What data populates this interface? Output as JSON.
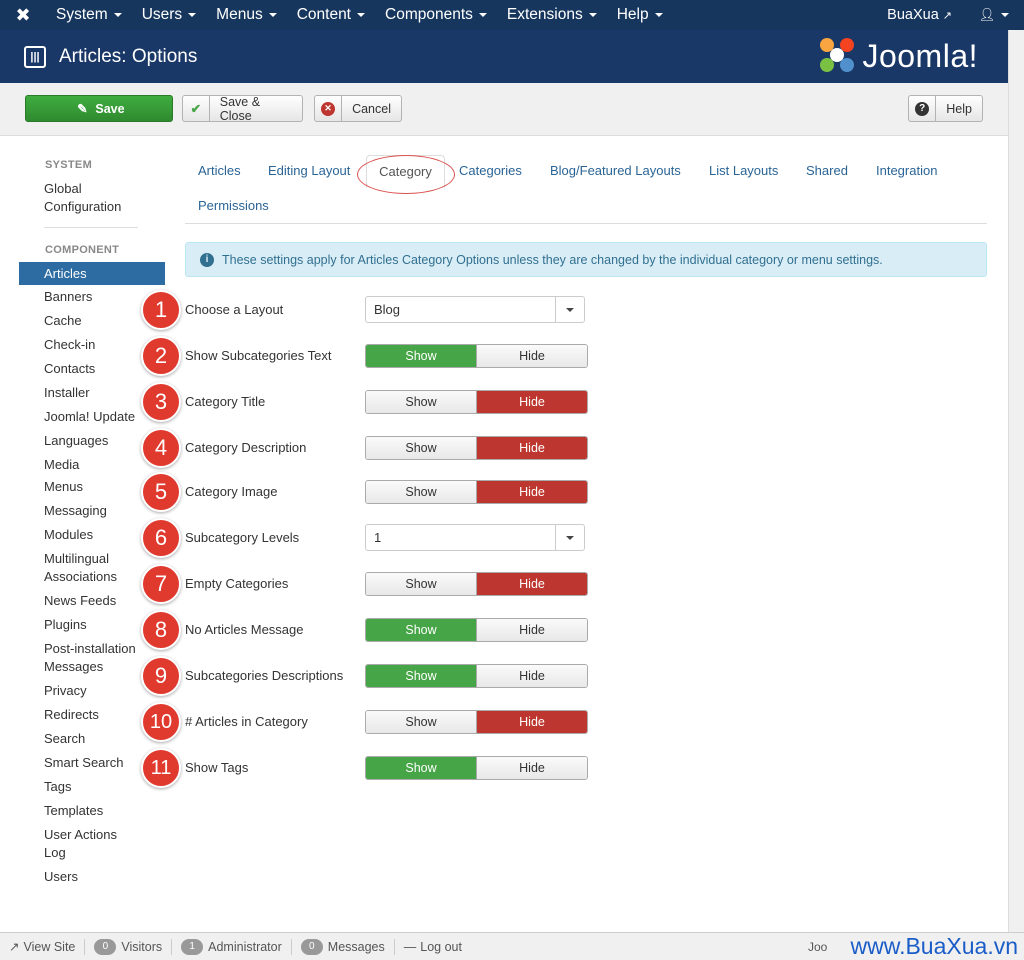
{
  "topnav": {
    "menu": [
      "System",
      "Users",
      "Menus",
      "Content",
      "Components",
      "Extensions",
      "Help"
    ],
    "site_name": "BuaXua"
  },
  "title": "Articles: Options",
  "brand": "Joomla!",
  "toolbar": {
    "save": "Save",
    "save_close": "Save & Close",
    "cancel": "Cancel",
    "help": "Help"
  },
  "sidebar": {
    "system_heading": "SYSTEM",
    "global_line1": "Global",
    "global_line2": "Configuration",
    "component_heading": "COMPONENT",
    "active": "Articles",
    "items": [
      "Banners",
      "Cache",
      "Check-in",
      "Contacts",
      "Installer",
      "Joomla! Update",
      "Languages",
      "Media",
      "Menus",
      "Messaging",
      "Modules",
      "Multilingual",
      "Associations",
      "News Feeds",
      "Plugins",
      "Post-installation",
      "Messages",
      "Privacy",
      "Redirects",
      "Search",
      "Smart Search",
      "Tags",
      "Templates",
      "User Actions",
      "Log",
      "Users"
    ]
  },
  "tabs": [
    "Articles",
    "Editing Layout",
    "Category",
    "Categories",
    "Blog/Featured Layouts",
    "List Layouts",
    "Shared",
    "Integration",
    "Permissions"
  ],
  "info_message": "These settings apply for Articles Category Options unless they are changed by the individual category or menu settings.",
  "rows": [
    {
      "num": "1",
      "label": "Choose a Layout",
      "type": "select",
      "value": "Blog"
    },
    {
      "num": "2",
      "label": "Show Subcategories Text",
      "type": "toggle",
      "value": "Show"
    },
    {
      "num": "3",
      "label": "Category Title",
      "type": "toggle",
      "value": "Hide"
    },
    {
      "num": "4",
      "label": "Category Description",
      "type": "toggle",
      "value": "Hide"
    },
    {
      "num": "5",
      "label": "Category Image",
      "type": "toggle",
      "value": "Hide"
    },
    {
      "num": "6",
      "label": "Subcategory Levels",
      "type": "select",
      "value": "1"
    },
    {
      "num": "7",
      "label": "Empty Categories",
      "type": "toggle",
      "value": "Hide"
    },
    {
      "num": "8",
      "label": "No Articles Message",
      "type": "toggle",
      "value": "Show"
    },
    {
      "num": "9",
      "label": "Subcategories Descriptions",
      "type": "toggle",
      "value": "Show"
    },
    {
      "num": "10",
      "label": "# Articles in Category",
      "type": "toggle",
      "value": "Hide"
    },
    {
      "num": "11",
      "label": "Show Tags",
      "type": "toggle",
      "value": "Show"
    }
  ],
  "toggle_labels": {
    "show": "Show",
    "hide": "Hide"
  },
  "footer": {
    "view_site": "View Site",
    "visitors_count": "0",
    "visitors": "Visitors",
    "admin_count": "1",
    "admin": "Administrator",
    "messages_count": "0",
    "messages": "Messages",
    "logout": "Log out",
    "right_text": "Joo",
    "watermark": "www.BuaXua.vn"
  },
  "colors": {
    "nav": "#17365d",
    "title": "#1a3867",
    "green": "#46a546",
    "red": "#bd362f",
    "link": "#2a6496",
    "badge": "#e03a2f"
  }
}
